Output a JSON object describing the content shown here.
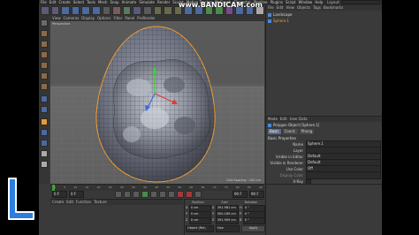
{
  "watermark": "www.BANDICAM.com",
  "window": {
    "layout_label": "Layout:"
  },
  "menubar": {
    "items": [
      "File",
      "Edit",
      "Create",
      "Select",
      "Tools",
      "Mesh",
      "Snap",
      "Animate",
      "Simulate",
      "Render",
      "Sculpt",
      "Motion Tracker",
      "MoGraph",
      "Character",
      "Pipeline",
      "Plugins",
      "Script",
      "Window",
      "Help"
    ]
  },
  "viewport": {
    "menu": [
      "View",
      "Cameras",
      "Display",
      "Options",
      "Filter",
      "Panel",
      "ProRender"
    ],
    "camera_label": "Perspective",
    "grid_spacing": "Grid Spacing : 100 cm"
  },
  "object_manager": {
    "menu": [
      "File",
      "Edit",
      "View",
      "Objects",
      "Tags",
      "Bookmarks"
    ],
    "objects": [
      {
        "name": "Landscape"
      },
      {
        "name": "Sphere.1"
      }
    ]
  },
  "attributes": {
    "menu": [
      "Mode",
      "Edit",
      "User Data"
    ],
    "header": "Polygon Object [Sphere.1]",
    "tabs": [
      "Basic",
      "Coord.",
      "Phong"
    ],
    "section": "Basic Properties",
    "rows": [
      {
        "label": "Name",
        "value": "Sphere.1"
      },
      {
        "label": "Layer",
        "value": ""
      },
      {
        "label": "Visible in Editor",
        "value": "Default"
      },
      {
        "label": "Visible in Renderer",
        "value": "Default"
      },
      {
        "label": "Use Color",
        "value": "Off"
      },
      {
        "label": "Display Color",
        "value": ""
      },
      {
        "label": "X-Ray",
        "value": ""
      }
    ]
  },
  "timeline": {
    "ticks": [
      "0",
      "5",
      "10",
      "15",
      "20",
      "25",
      "30",
      "35",
      "40",
      "45",
      "50",
      "55",
      "60",
      "65",
      "70",
      "75",
      "80",
      "85",
      "90"
    ],
    "start": "0 F",
    "current": "0 F",
    "end": "90 F",
    "end2": "90 F"
  },
  "materials": {
    "menu": [
      "Create",
      "Edit",
      "Function",
      "Texture"
    ]
  },
  "coordinates": {
    "headers": [
      "Position",
      "Size",
      "Rotation"
    ],
    "rows": [
      {
        "axis": "X",
        "pos": "0 cm",
        "size": "391.981 cm",
        "rot_label": "H",
        "rot": "0 °"
      },
      {
        "axis": "Y",
        "pos": "0 cm",
        "size": "500.189 cm",
        "rot_label": "P",
        "rot": "0 °"
      },
      {
        "axis": "Z",
        "pos": "0 cm",
        "size": "391.909 cm",
        "rot_label": "B",
        "rot": "0 °"
      }
    ],
    "mode": "Object (Rel)",
    "size_mode": "Size",
    "apply": "Apply"
  },
  "colors": {
    "app_bg": "#3a3a3a",
    "accent_orange": "#e89a3a",
    "selection_outline": "#f0a030",
    "logo_blue": "#2a7fe0"
  }
}
